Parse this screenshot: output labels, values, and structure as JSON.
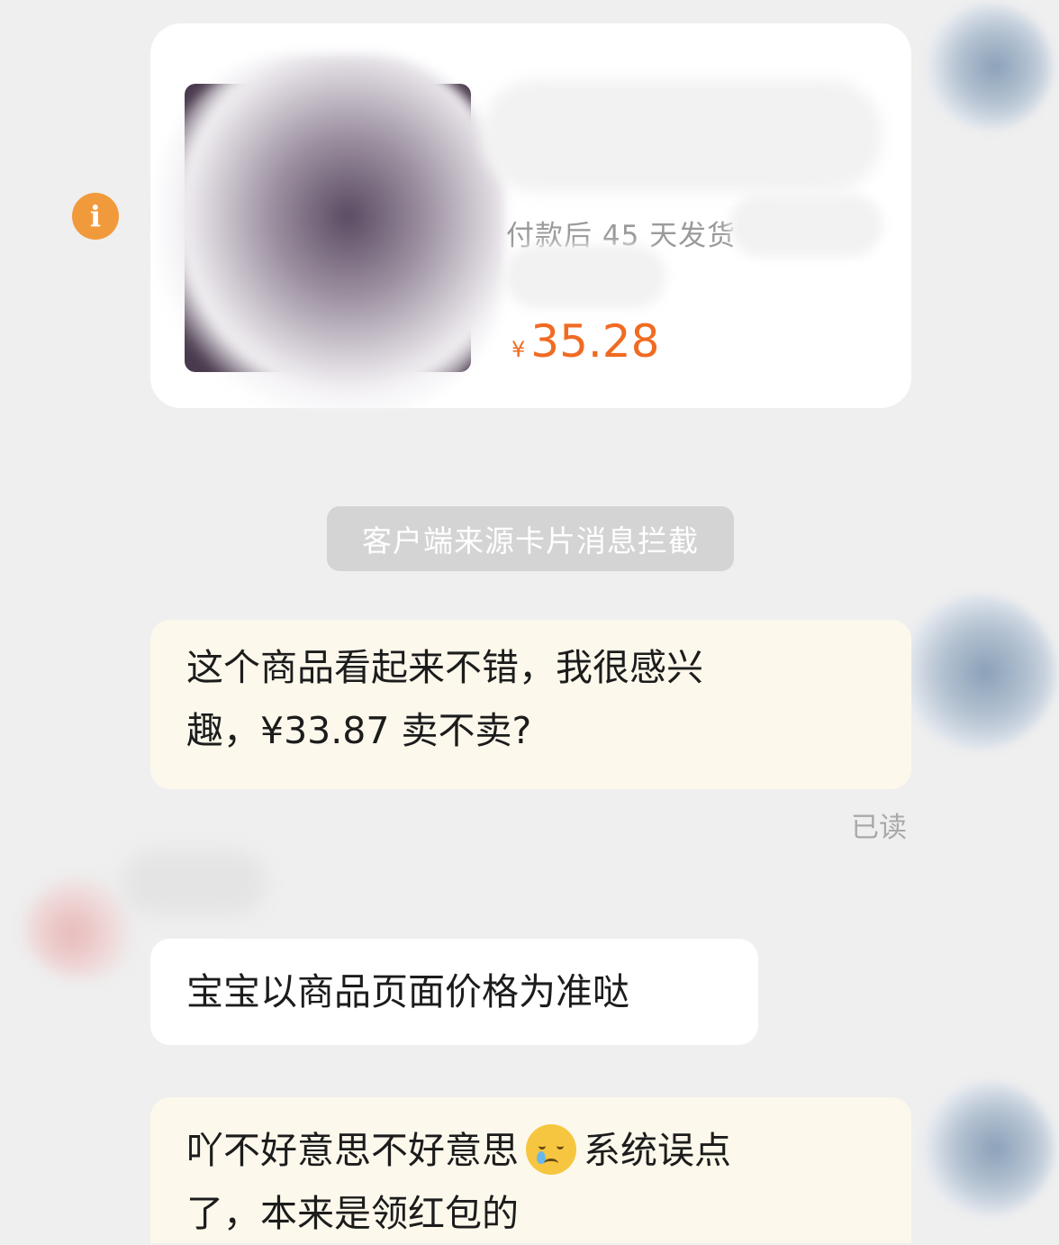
{
  "product_card": {
    "shipping_text": "付款后 45 天发货",
    "currency": "¥",
    "price": "35.28"
  },
  "system_notice": "客户端来源卡片消息拦截",
  "messages": [
    {
      "sender": "me",
      "lines": [
        "这个商品看起来不错，我很感兴",
        "趣，¥33.87 卖不卖?"
      ]
    },
    {
      "sender": "them",
      "lines": [
        "宝宝以商品页面价格为准哒"
      ]
    },
    {
      "sender": "me",
      "line1_before_emoji": "吖不好意思不好意思",
      "emoji": "crying-face",
      "line1_after_emoji": "系统误点",
      "line2": "了，本来是领红包的"
    }
  ],
  "read_status": "已读",
  "colors": {
    "background": "#efefef",
    "price": "#f06b22",
    "info_icon": "#f19a3c",
    "my_bubble": "#fdf8ec",
    "their_bubble": "#ffffff",
    "notice_bg": "#d4d4d4"
  }
}
